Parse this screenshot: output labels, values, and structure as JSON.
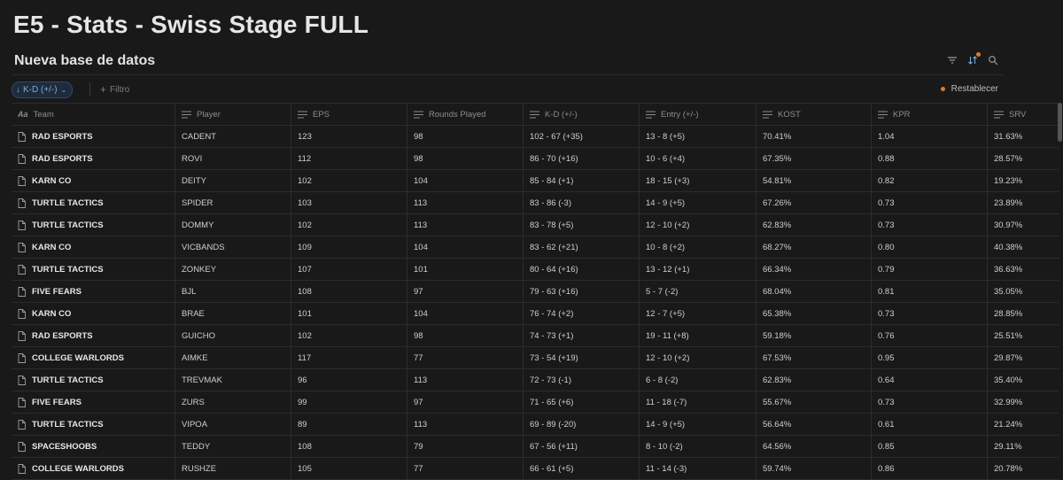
{
  "page": {
    "title": "E5 - Stats - Swiss Stage FULL"
  },
  "database": {
    "title": "Nueva base de datos",
    "icons": [
      "filter-icon",
      "sort-icon",
      "search-icon"
    ]
  },
  "filterbar": {
    "sort_chip": "K-D (+/-)",
    "add_filter": "Filtro",
    "reset": "Restablecer"
  },
  "table": {
    "columns": [
      "Team",
      "Player",
      "EPS",
      "Rounds Played",
      "K-D (+/-)",
      "Entry (+/-)",
      "KOST",
      "KPR",
      "SRV"
    ],
    "rows": [
      [
        "RAD ESPORTS",
        "CADENT",
        "123",
        "98",
        "102 - 67 (+35)",
        "13 - 8 (+5)",
        "70.41%",
        "1.04",
        "31.63%"
      ],
      [
        "RAD ESPORTS",
        "ROVI",
        "112",
        "98",
        "86 - 70 (+16)",
        "10 - 6 (+4)",
        "67.35%",
        "0.88",
        "28.57%"
      ],
      [
        "KARN CO",
        "DEITY",
        "102",
        "104",
        "85 - 84 (+1)",
        "18 - 15 (+3)",
        "54.81%",
        "0.82",
        "19.23%"
      ],
      [
        "TURTLE TACTICS",
        "SPIDER",
        "103",
        "113",
        "83 - 86 (-3)",
        "14 - 9 (+5)",
        "67.26%",
        "0.73",
        "23.89%"
      ],
      [
        "TURTLE TACTICS",
        "DOMMY",
        "102",
        "113",
        "83 - 78 (+5)",
        "12 - 10 (+2)",
        "62.83%",
        "0.73",
        "30.97%"
      ],
      [
        "KARN CO",
        "VICBANDS",
        "109",
        "104",
        "83 - 62 (+21)",
        "10 - 8 (+2)",
        "68.27%",
        "0.80",
        "40.38%"
      ],
      [
        "TURTLE TACTICS",
        "ZONKEY",
        "107",
        "101",
        "80 - 64 (+16)",
        "13 - 12 (+1)",
        "66.34%",
        "0.79",
        "36.63%"
      ],
      [
        "FIVE FEARS",
        "BJL",
        "108",
        "97",
        "79 - 63 (+16)",
        "5 - 7 (-2)",
        "68.04%",
        "0.81",
        "35.05%"
      ],
      [
        "KARN CO",
        "BRAE",
        "101",
        "104",
        "76 - 74 (+2)",
        "12 - 7 (+5)",
        "65.38%",
        "0.73",
        "28.85%"
      ],
      [
        "RAD ESPORTS",
        "GUICHO",
        "102",
        "98",
        "74 - 73 (+1)",
        "19 - 11 (+8)",
        "59.18%",
        "0.76",
        "25.51%"
      ],
      [
        "COLLEGE WARLORDS",
        "AIMKE",
        "117",
        "77",
        "73 - 54 (+19)",
        "12 - 10 (+2)",
        "67.53%",
        "0.95",
        "29.87%"
      ],
      [
        "TURTLE TACTICS",
        "TREVMAK",
        "96",
        "113",
        "72 - 73 (-1)",
        "6 - 8 (-2)",
        "62.83%",
        "0.64",
        "35.40%"
      ],
      [
        "FIVE FEARS",
        "ZURS",
        "99",
        "97",
        "71 - 65 (+6)",
        "11 - 18 (-7)",
        "55.67%",
        "0.73",
        "32.99%"
      ],
      [
        "TURTLE TACTICS",
        "VIPOA",
        "89",
        "113",
        "69 - 89 (-20)",
        "14 - 9 (+5)",
        "56.64%",
        "0.61",
        "21.24%"
      ],
      [
        "SPACESHOOBS",
        "TEDDY",
        "108",
        "79",
        "67 - 56 (+11)",
        "8 - 10 (-2)",
        "64.56%",
        "0.85",
        "29.11%"
      ],
      [
        "COLLEGE WARLORDS",
        "RUSHZE",
        "105",
        "77",
        "66 - 61 (+5)",
        "11 - 14 (-3)",
        "59.74%",
        "0.86",
        "20.78%"
      ]
    ]
  },
  "colors": {
    "background": "#191919",
    "accent": "#79aee3",
    "reset_dot": "#e07b2a"
  }
}
